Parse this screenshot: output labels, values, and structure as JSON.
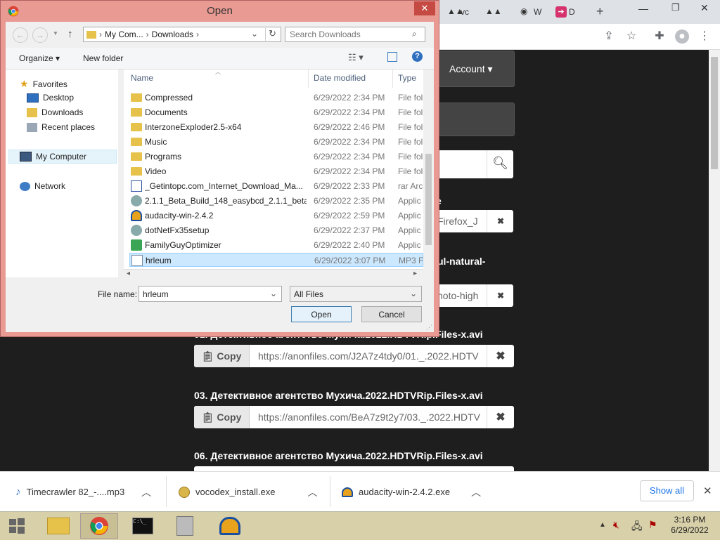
{
  "browser": {
    "tabs": [
      {
        "label": "vc"
      },
      {
        "label": ""
      },
      {
        "label": "W"
      },
      {
        "label": "D"
      }
    ],
    "new_tab": "+",
    "window_controls": {
      "minimize": "—",
      "maximize": "❐",
      "close": "✕"
    }
  },
  "page": {
    "account_label": "Account ▾",
    "partial_texts": [
      "e",
      "ul-natural-"
    ],
    "link_rows": [
      {
        "url": "Firefox_J",
        "copy": ""
      },
      {
        "url": "hoto-high",
        "copy": ""
      }
    ],
    "files": [
      {
        "title": "01. Детективное агентство Мухича.2022.HDTVRip.Files-x.avi",
        "url": "https://anonfiles.com/J2A7z4tdy0/01._.2022.HDTV",
        "copy": "Copy"
      },
      {
        "title": "03. Детективное агентство Мухича.2022.HDTVRip.Files-x.avi",
        "url": "https://anonfiles.com/BeA7z9t2y7/03._.2022.HDTV",
        "copy": "Copy"
      },
      {
        "title": "06. Детективное агентство Мухича.2022.HDTVRip.Files-x.avi",
        "url": "",
        "copy": ""
      }
    ],
    "close_symbol": "✖"
  },
  "downloads": {
    "items": [
      {
        "name": "Timecrawler 82_-....mp3"
      },
      {
        "name": "vocodex_install.exe"
      },
      {
        "name": "audacity-win-2.4.2.exe"
      }
    ],
    "show_all": "Show all",
    "close": "✕"
  },
  "taskbar": {
    "time": "3:16 PM",
    "date": "6/29/2022"
  },
  "dialog": {
    "title": "Open",
    "close": "✕",
    "breadcrumb": [
      "My Com...",
      "Downloads"
    ],
    "search_placeholder": "Search Downloads",
    "organize": "Organize ▾",
    "new_folder": "New folder",
    "nav": {
      "favorites": "Favorites",
      "desktop": "Desktop",
      "downloads": "Downloads",
      "recent": "Recent places",
      "computer": "My Computer",
      "network": "Network"
    },
    "columns": {
      "name": "Name",
      "date": "Date modified",
      "type": "Type"
    },
    "files": [
      {
        "name": "Compressed",
        "date": "6/29/2022 2:34 PM",
        "type": "File fol",
        "icon": "folder"
      },
      {
        "name": "Documents",
        "date": "6/29/2022 2:34 PM",
        "type": "File fol",
        "icon": "folder"
      },
      {
        "name": "InterzoneExploder2.5-x64",
        "date": "6/29/2022 2:46 PM",
        "type": "File fol",
        "icon": "folder"
      },
      {
        "name": "Music",
        "date": "6/29/2022 2:34 PM",
        "type": "File fol",
        "icon": "folder"
      },
      {
        "name": "Programs",
        "date": "6/29/2022 2:34 PM",
        "type": "File fol",
        "icon": "folder"
      },
      {
        "name": "Video",
        "date": "6/29/2022 2:34 PM",
        "type": "File fol",
        "icon": "folder"
      },
      {
        "name": "_Getintopc.com_Internet_Download_Ma...",
        "date": "6/29/2022 2:33 PM",
        "type": "rar Arc",
        "icon": "archive"
      },
      {
        "name": "2.1.1_Beta_Build_148_easybcd_2.1.1_beta_...",
        "date": "6/29/2022 2:35 PM",
        "type": "Applic",
        "icon": "app"
      },
      {
        "name": "audacity-win-2.4.2",
        "date": "6/29/2022 2:59 PM",
        "type": "Applic",
        "icon": "audacity"
      },
      {
        "name": "dotNetFx35setup",
        "date": "6/29/2022 2:37 PM",
        "type": "Applic",
        "icon": "app"
      },
      {
        "name": "FamilyGuyOptimizer",
        "date": "6/29/2022 2:40 PM",
        "type": "Applic",
        "icon": "check"
      },
      {
        "name": "hrleum",
        "date": "6/29/2022 3:07 PM",
        "type": "MP3 F",
        "icon": "music",
        "selected": true
      }
    ],
    "filename_label": "File name:",
    "filename_value": "hrleum",
    "filter": "All Files",
    "open_button": "Open",
    "cancel_button": "Cancel"
  }
}
